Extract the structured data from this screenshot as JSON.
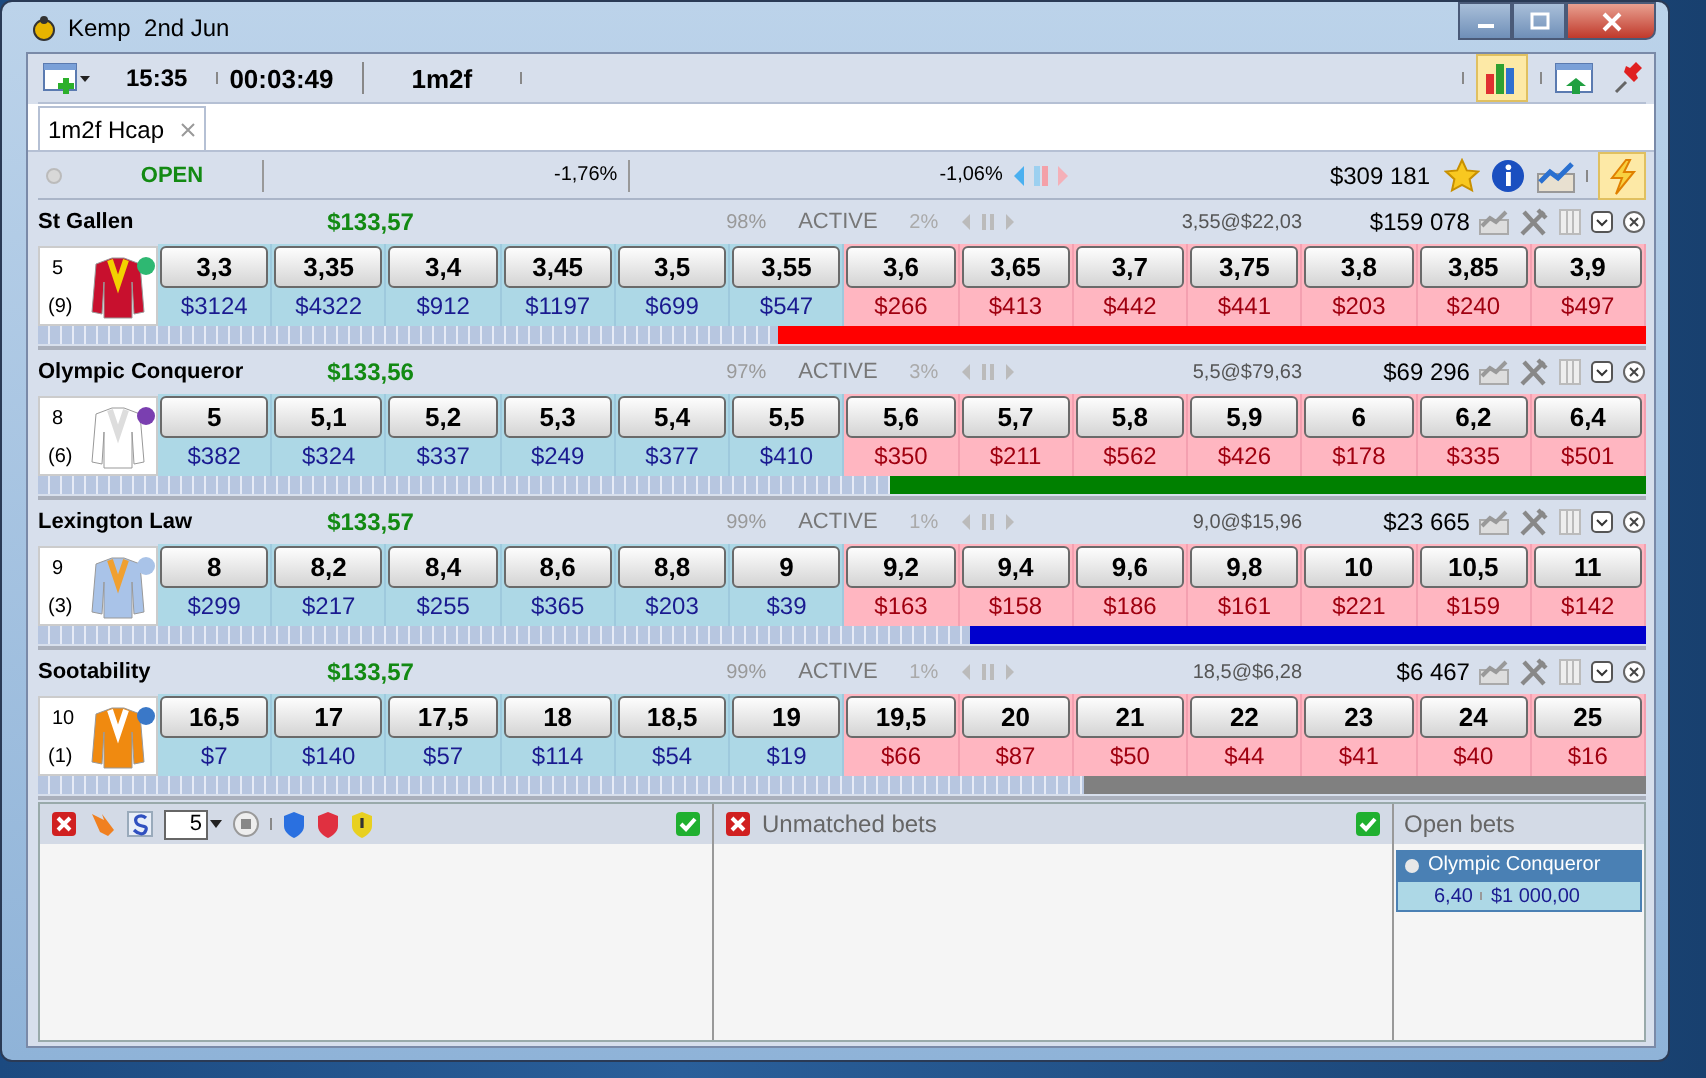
{
  "window": {
    "title": "Kemp  2nd Jun"
  },
  "toolbar": {
    "time": "15:35",
    "countdown": "00:03:49",
    "distance": "1m2f"
  },
  "tabs": [
    {
      "label": "1m2f Hcap",
      "selected": true
    }
  ],
  "market": {
    "status": "OPEN",
    "back_percent": "-1,76%",
    "lay_percent": "-1,06%",
    "matched": "$309 181"
  },
  "runners": [
    {
      "name": "St Gallen",
      "win_amount": "$133,57",
      "percent": "98%",
      "status": "ACTIVE",
      "change": "2%",
      "last_traded": "3,55@$22,03",
      "matched": "$159 078",
      "number": "5",
      "draw": "(9)",
      "back": [
        {
          "price": "3,3",
          "amount": "$3124"
        },
        {
          "price": "3,35",
          "amount": "$4322"
        },
        {
          "price": "3,4",
          "amount": "$912"
        },
        {
          "price": "3,45",
          "amount": "$1197"
        },
        {
          "price": "3,5",
          "amount": "$699"
        },
        {
          "price": "3,55",
          "amount": "$547"
        }
      ],
      "lay": [
        {
          "price": "3,6",
          "amount": "$266"
        },
        {
          "price": "3,65",
          "amount": "$413"
        },
        {
          "price": "3,7",
          "amount": "$442"
        },
        {
          "price": "3,75",
          "amount": "$441"
        },
        {
          "price": "3,8",
          "amount": "$203"
        },
        {
          "price": "3,85",
          "amount": "$240"
        },
        {
          "price": "3,9",
          "amount": "$497"
        }
      ],
      "bar": {
        "level": 0.54,
        "color": "#ff0000"
      }
    },
    {
      "name": "Olympic Conqueror",
      "win_amount": "$133,56",
      "percent": "97%",
      "status": "ACTIVE",
      "change": "3%",
      "last_traded": "5,5@$79,63",
      "matched": "$69 296",
      "number": "8",
      "draw": "(6)",
      "back": [
        {
          "price": "5",
          "amount": "$382"
        },
        {
          "price": "5,1",
          "amount": "$324"
        },
        {
          "price": "5,2",
          "amount": "$337"
        },
        {
          "price": "5,3",
          "amount": "$249"
        },
        {
          "price": "5,4",
          "amount": "$377"
        },
        {
          "price": "5,5",
          "amount": "$410"
        }
      ],
      "lay": [
        {
          "price": "5,6",
          "amount": "$350"
        },
        {
          "price": "5,7",
          "amount": "$211"
        },
        {
          "price": "5,8",
          "amount": "$562"
        },
        {
          "price": "5,9",
          "amount": "$426"
        },
        {
          "price": "6",
          "amount": "$178"
        },
        {
          "price": "6,2",
          "amount": "$335"
        },
        {
          "price": "6,4",
          "amount": "$501"
        }
      ],
      "bar": {
        "level": 0.47,
        "color": "#008000"
      }
    },
    {
      "name": "Lexington Law",
      "win_amount": "$133,57",
      "percent": "99%",
      "status": "ACTIVE",
      "change": "1%",
      "last_traded": "9,0@$15,96",
      "matched": "$23 665",
      "number": "9",
      "draw": "(3)",
      "back": [
        {
          "price": "8",
          "amount": "$299"
        },
        {
          "price": "8,2",
          "amount": "$217"
        },
        {
          "price": "8,4",
          "amount": "$255"
        },
        {
          "price": "8,6",
          "amount": "$365"
        },
        {
          "price": "8,8",
          "amount": "$203"
        },
        {
          "price": "9",
          "amount": "$39"
        }
      ],
      "lay": [
        {
          "price": "9,2",
          "amount": "$163"
        },
        {
          "price": "9,4",
          "amount": "$158"
        },
        {
          "price": "9,6",
          "amount": "$186"
        },
        {
          "price": "9,8",
          "amount": "$161"
        },
        {
          "price": "10",
          "amount": "$221"
        },
        {
          "price": "10,5",
          "amount": "$159"
        },
        {
          "price": "11",
          "amount": "$142"
        }
      ],
      "bar": {
        "level": 0.42,
        "color": "#0000cd"
      }
    },
    {
      "name": "Sootability",
      "win_amount": "$133,57",
      "percent": "99%",
      "status": "ACTIVE",
      "change": "1%",
      "last_traded": "18,5@$6,28",
      "matched": "$6 467",
      "number": "10",
      "draw": "(1)",
      "back": [
        {
          "price": "16,5",
          "amount": "$7"
        },
        {
          "price": "17",
          "amount": "$140"
        },
        {
          "price": "17,5",
          "amount": "$57"
        },
        {
          "price": "18",
          "amount": "$114"
        },
        {
          "price": "18,5",
          "amount": "$54"
        },
        {
          "price": "19",
          "amount": "$19"
        }
      ],
      "lay": [
        {
          "price": "19,5",
          "amount": "$66"
        },
        {
          "price": "20",
          "amount": "$87"
        },
        {
          "price": "21",
          "amount": "$50"
        },
        {
          "price": "22",
          "amount": "$44"
        },
        {
          "price": "23",
          "amount": "$41"
        },
        {
          "price": "24",
          "amount": "$40"
        },
        {
          "price": "25",
          "amount": "$16"
        }
      ],
      "bar": {
        "level": 0.35,
        "color": "#808080"
      }
    }
  ],
  "bets_panel": {
    "stake": "5"
  },
  "unmatched": {
    "title": "Unmatched bets"
  },
  "open_bets": {
    "title": "Open bets",
    "items": [
      {
        "runner": "Olympic Conqueror",
        "price": "6,40",
        "stake": "$1 000,00"
      }
    ]
  }
}
